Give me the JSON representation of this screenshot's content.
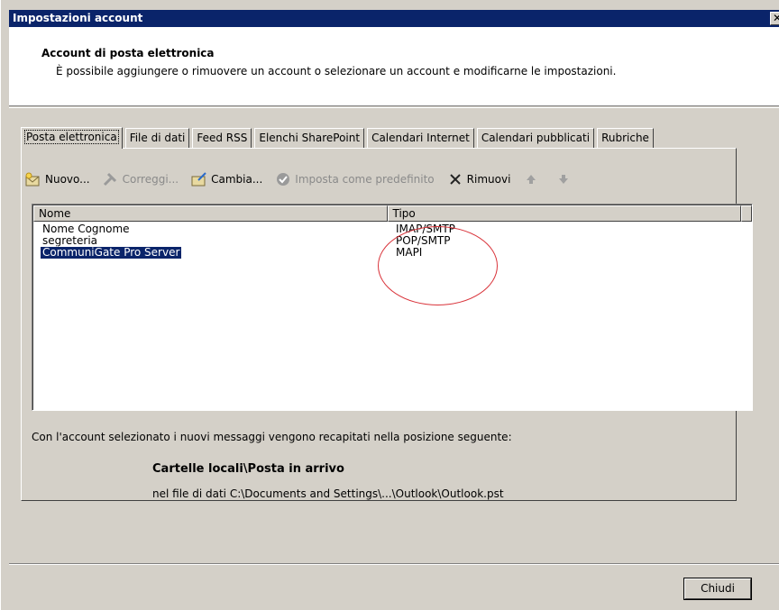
{
  "window": {
    "title": "Impostazioni account",
    "close_glyph": "✕"
  },
  "header": {
    "title": "Account di posta elettronica",
    "description": "È possibile aggiungere o rimuovere un account o selezionare un account e modificarne le impostazioni."
  },
  "tabs": [
    {
      "label": "Posta elettronica",
      "active": true
    },
    {
      "label": "File di dati"
    },
    {
      "label": "Feed RSS"
    },
    {
      "label": "Elenchi SharePoint"
    },
    {
      "label": "Calendari Internet"
    },
    {
      "label": "Calendari pubblicati"
    },
    {
      "label": "Rubriche"
    }
  ],
  "toolbar": {
    "new": {
      "label": "Nuovo...",
      "icon": "new-account-icon"
    },
    "repair": {
      "label": "Correggi...",
      "icon": "repair-icon",
      "disabled": true
    },
    "change": {
      "label": "Cambia...",
      "icon": "change-icon"
    },
    "default": {
      "label": "Imposta come predefinito",
      "icon": "check-icon",
      "disabled": true
    },
    "remove": {
      "label": "Rimuovi",
      "icon": "remove-icon"
    },
    "up_icon": "arrow-up-icon",
    "down_icon": "arrow-down-icon"
  },
  "list": {
    "columns": [
      "Nome",
      "Tipo"
    ],
    "rows": [
      {
        "name": "Nome Cognome",
        "type": "IMAP/SMTP"
      },
      {
        "name": "segreteria",
        "type": "POP/SMTP"
      },
      {
        "name": "CommuniGate Pro Server",
        "type": "MAPI",
        "selected": true
      }
    ]
  },
  "delivery": {
    "intro": "Con l'account selezionato i nuovi messaggi vengono recapitati nella posizione seguente:",
    "folder": "Cartelle locali\\Posta in arrivo",
    "file": "nel file di dati C:\\Documents and Settings\\...\\Outlook\\Outlook.pst"
  },
  "buttons": {
    "close": "Chiudi"
  },
  "colors": {
    "title_bar": "#0a246a",
    "annotation_circle": "#d9333a",
    "selection": "#0a246a"
  }
}
